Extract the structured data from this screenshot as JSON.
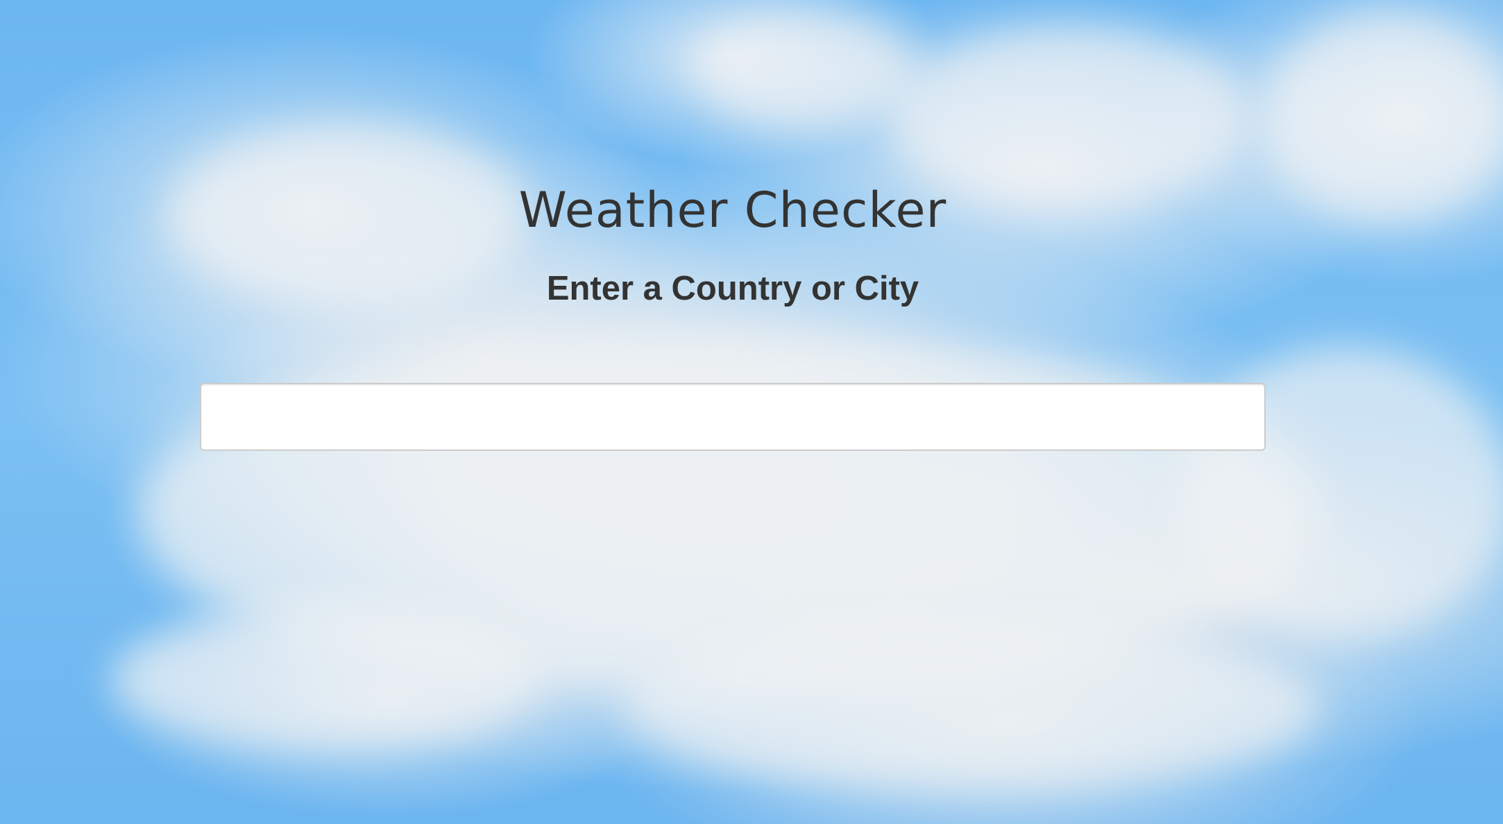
{
  "page": {
    "title": "Weather Checker",
    "prompt": "Enter a Country or City"
  },
  "search": {
    "value": "",
    "placeholder": ""
  },
  "colors": {
    "sky": "#6fb8f2",
    "cloud": "#eceef0",
    "text": "#333333",
    "input_bg": "#ffffff",
    "input_border": "#cccccc"
  },
  "background": {
    "description_icon": "sky-clouds-image"
  }
}
